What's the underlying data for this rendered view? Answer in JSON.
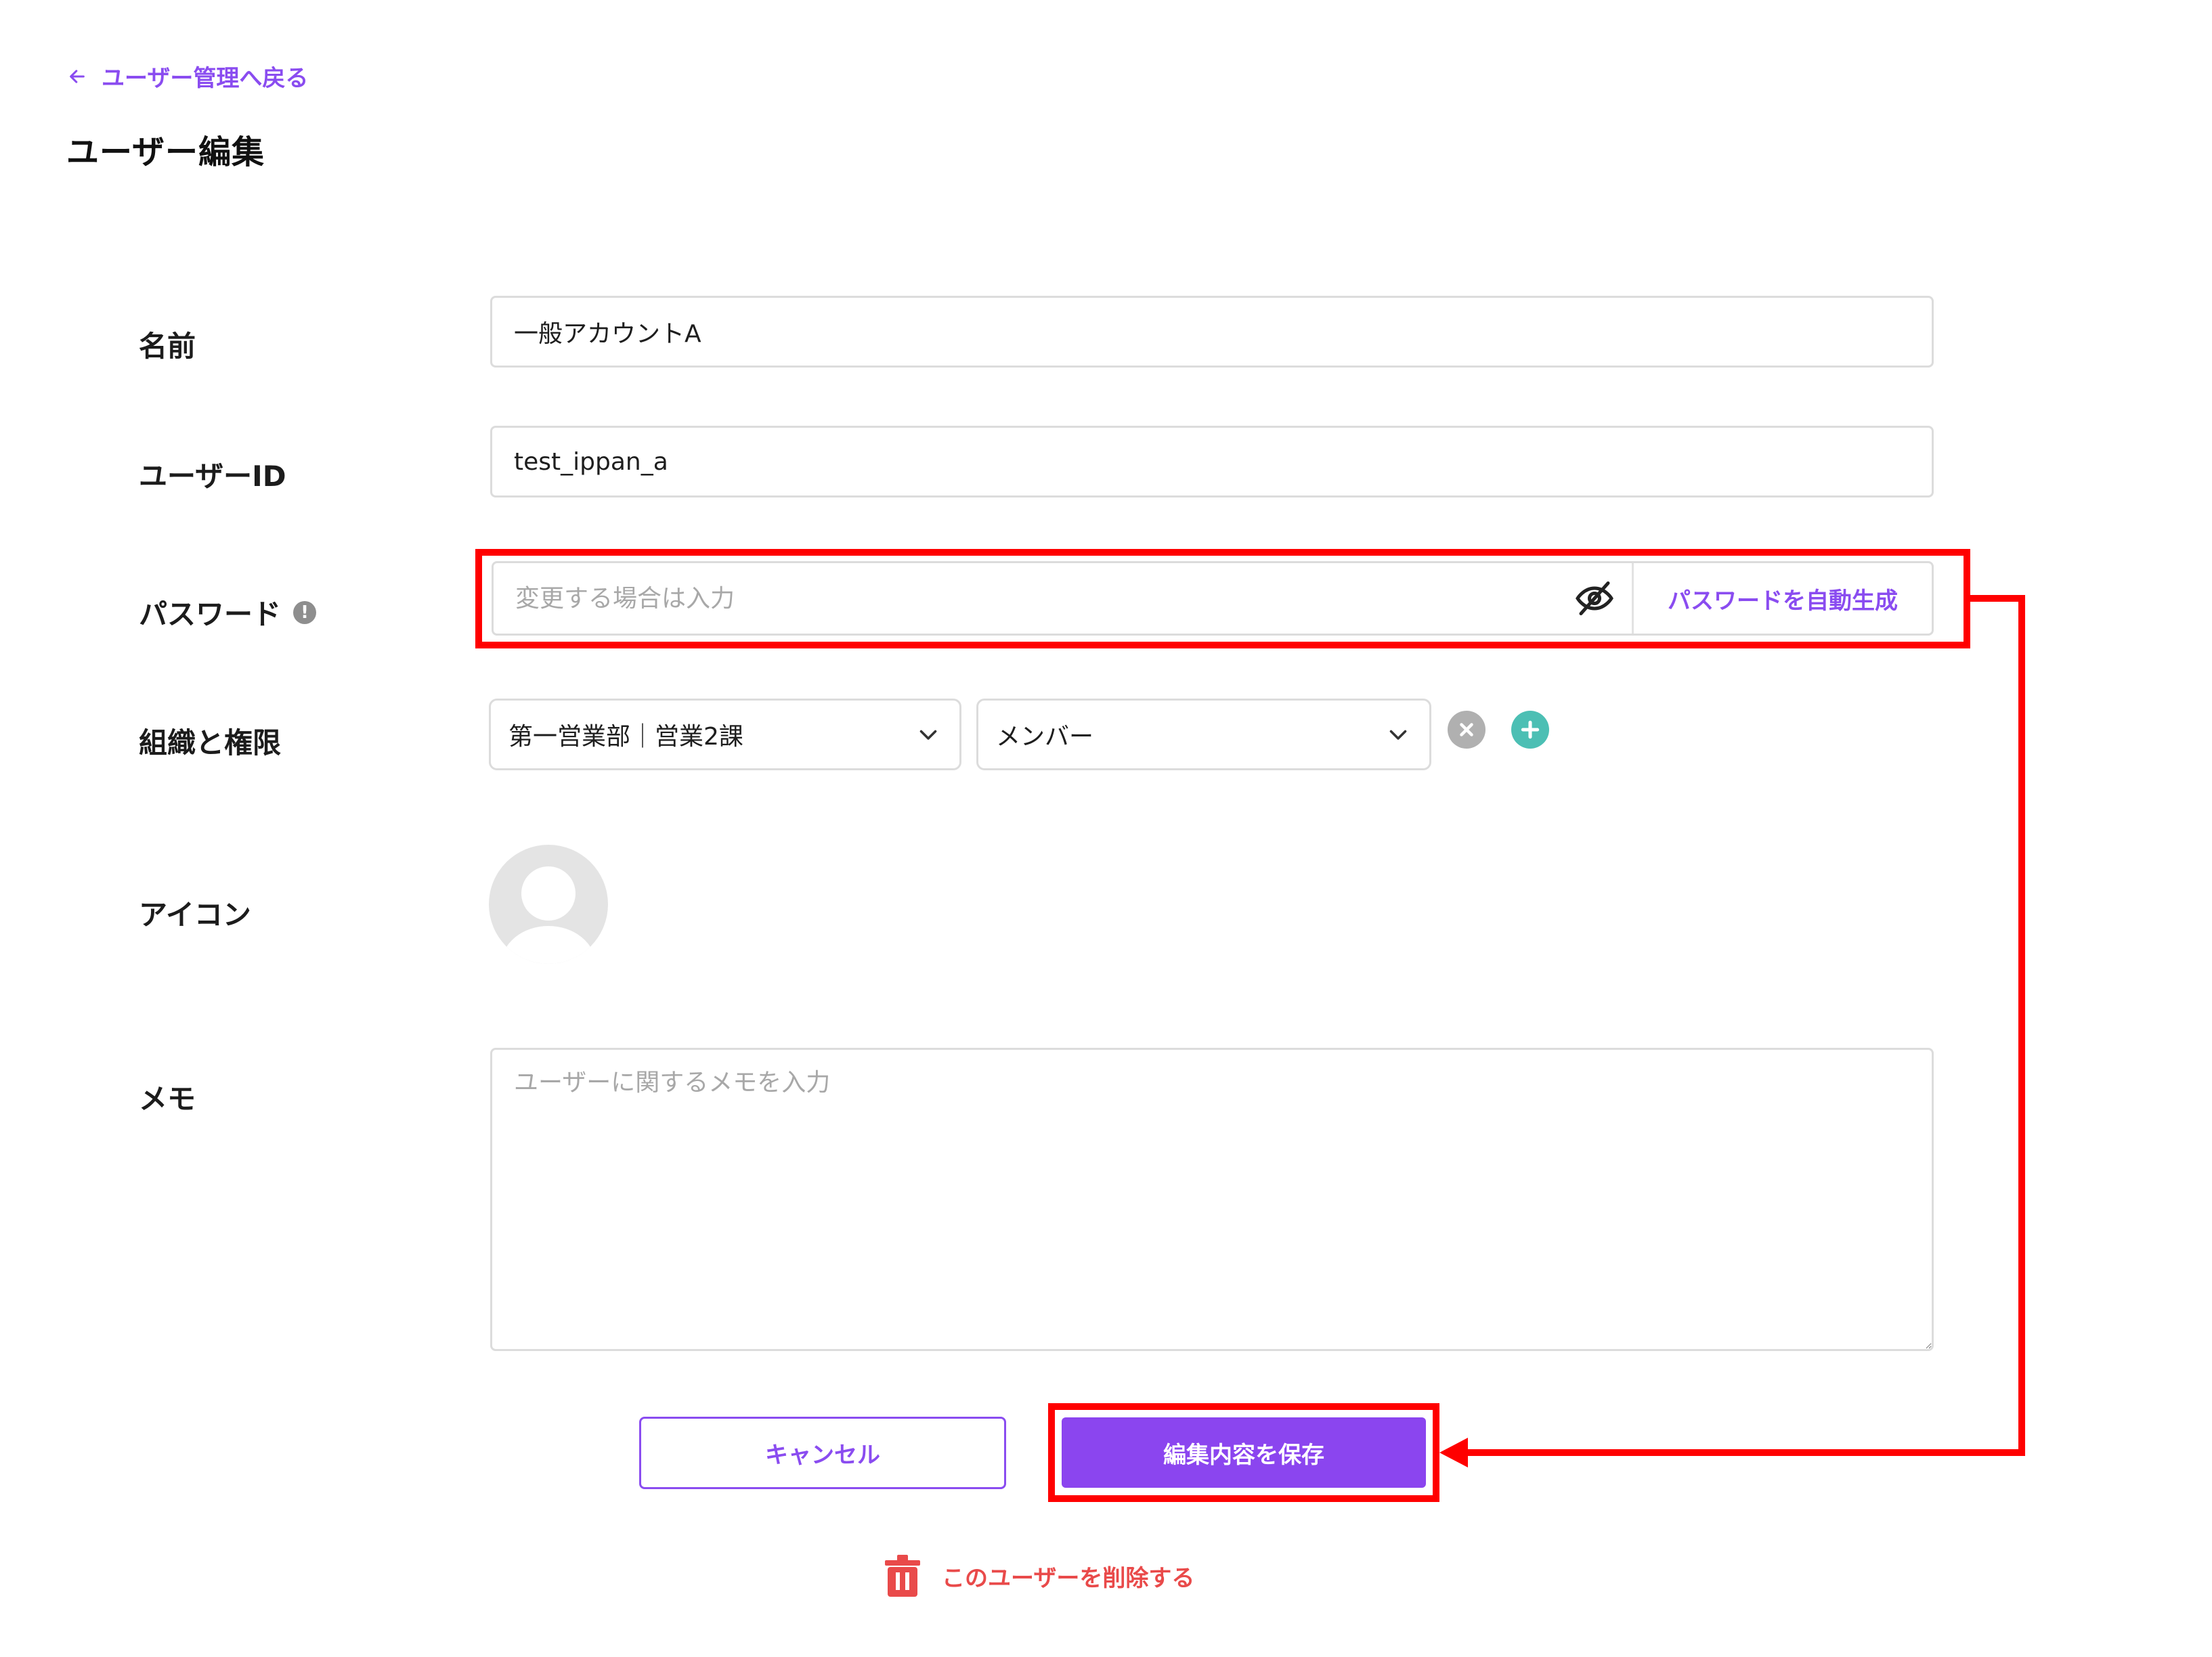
{
  "nav": {
    "back_label": "ユーザー管理へ戻る"
  },
  "page": {
    "title": "ユーザー編集"
  },
  "form": {
    "name": {
      "label": "名前",
      "value": "一般アカウントA"
    },
    "user_id": {
      "label": "ユーザーID",
      "value": "test_ippan_a"
    },
    "password": {
      "label": "パスワード",
      "info_icon": "!",
      "placeholder": "変更する場合は入力",
      "generate_label": "パスワードを自動生成"
    },
    "org": {
      "label": "組織と権限",
      "department": "第一営業部｜営業2課",
      "role": "メンバー"
    },
    "icon": {
      "label": "アイコン"
    },
    "memo": {
      "label": "メモ",
      "placeholder": "ユーザーに関するメモを入力"
    }
  },
  "actions": {
    "cancel_label": "キャンセル",
    "save_label": "編集内容を保存",
    "delete_label": "このユーザーを削除する"
  },
  "colors": {
    "accent": "#8a4cf0",
    "annotation": "#ff0000",
    "danger": "#e94a4a",
    "add": "#4cbfb4",
    "remove": "#b0b0b0"
  },
  "icons": [
    "arrow-left-icon",
    "info-icon",
    "eye-off-icon",
    "chevron-down-icon",
    "remove-circle-icon",
    "add-circle-icon",
    "default-avatar-icon",
    "trash-icon"
  ]
}
